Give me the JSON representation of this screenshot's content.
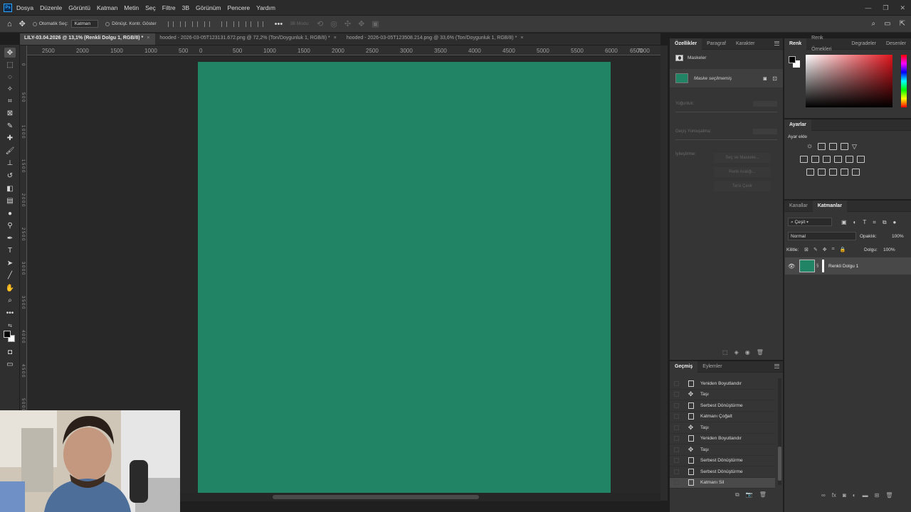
{
  "app": {
    "logo": "Ps"
  },
  "menu": [
    "Dosya",
    "Düzenle",
    "Görüntü",
    "Katman",
    "Metin",
    "Seç",
    "Filtre",
    "3B",
    "Görünüm",
    "Pencere",
    "Yardım"
  ],
  "options": {
    "auto_select": "Otomatik Seç:",
    "auto_select_value": "Katman",
    "show_transform": "Dönüşt. Kontr. Göster",
    "mode_3d": "3B Modu:"
  },
  "tabs": [
    {
      "label": "LILY-03.04.2026 @ 13,1% (Renkli Dolgu 1, RGB/8) *",
      "active": true
    },
    {
      "label": "hooded - 2026-03-05T123131.672.png @ 72,2% (Ton/Doygunluk 1, RGB/8) *",
      "active": false
    },
    {
      "label": "hooded - 2026-03-05T123508.214.png @ 33,6% (Ton/Doygunluk 1, RGB/8) *",
      "active": false
    }
  ],
  "ruler_top": [
    "2500",
    "2000",
    "1500",
    "1000",
    "500",
    "0",
    "500",
    "1000",
    "1500",
    "2000",
    "2500",
    "3000",
    "3500",
    "4000",
    "4500",
    "5000",
    "5500",
    "6000",
    "6500",
    "7000"
  ],
  "ruler_left": [
    "0",
    "5 0 0",
    "1 0 0 0",
    "1 5 0 0",
    "2 0 0 0",
    "2 5 0 0",
    "3 0 0 0",
    "3 5 0 0",
    "4 0 0 0",
    "4 5 0 0",
    "5 0 0 0"
  ],
  "properties": {
    "tabs": [
      "Özellikler",
      "Paragraf",
      "Karakter"
    ],
    "masks_label": "Maskeler",
    "mask_status": "Maske seçilmemiş",
    "density": "Yoğunluk:",
    "feather": "Geçiş Yumuşatma:",
    "refine": "İyileştirme:",
    "buttons": [
      "Seç ve Maskele...",
      "Renk Aralığı...",
      "Tersi Çevir"
    ]
  },
  "history": {
    "tabs": [
      "Geçmiş",
      "Eylemler"
    ],
    "items": [
      {
        "label": "Yeniden Boyutlandır",
        "icon": "doc-icon"
      },
      {
        "label": "Taşı",
        "icon": "move-icon"
      },
      {
        "label": "Serbest Dönüştürme",
        "icon": "doc-icon"
      },
      {
        "label": "Katmanı Çoğalt",
        "icon": "doc-icon"
      },
      {
        "label": "Taşı",
        "icon": "move-icon"
      },
      {
        "label": "Yeniden Boyutlandır",
        "icon": "doc-icon"
      },
      {
        "label": "Taşı",
        "icon": "move-icon"
      },
      {
        "label": "Serbest Dönüştürme",
        "icon": "doc-icon"
      },
      {
        "label": "Serbest Dönüştürme",
        "icon": "doc-icon"
      },
      {
        "label": "Katmanı Sil",
        "icon": "doc-icon",
        "current": true
      }
    ]
  },
  "color": {
    "tabs": [
      "Renk",
      "Renk Örnekleri",
      "Degradeler",
      "Desenler"
    ]
  },
  "adjustments": {
    "title": "Ayarlar",
    "add_label": "Ayar ekle"
  },
  "layers": {
    "tabs": [
      "Kanallar",
      "Katmanlar"
    ],
    "filter": "Çeşit",
    "blend_mode": "Normal",
    "opacity_label": "Opaklık:",
    "opacity": "100%",
    "lock_label": "Kilitle:",
    "fill_label": "Dolgu:",
    "fill": "100%",
    "items": [
      {
        "name": "Renkli Dolgu 1"
      }
    ]
  },
  "colors": {
    "fill": "#218565",
    "canvas_bg": "#282828",
    "panel_bg": "#353535"
  }
}
